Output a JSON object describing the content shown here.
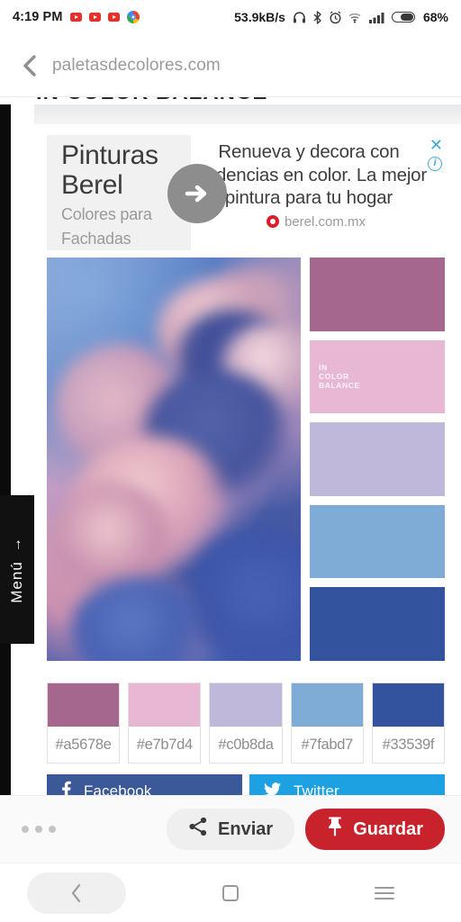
{
  "status_bar": {
    "clock": "4:19 PM",
    "notification_icons": [
      "youtube-icon",
      "youtube-icon",
      "youtube-icon",
      "chrome-icon"
    ],
    "network_speed": "53.9kB/s",
    "right_icons": [
      "headphones-icon",
      "bluetooth-icon",
      "alarm-icon",
      "wifi-icon",
      "cellular-signal-icon",
      "battery-icon"
    ],
    "battery_percent": "68%"
  },
  "browser": {
    "back_label": "back",
    "url": "paletasdecolores.com"
  },
  "page": {
    "clipped_heading": "IN COLOR BALANCE",
    "menu_tab": {
      "label": "Menú",
      "arrow": "→"
    }
  },
  "ad": {
    "brand_line1": "Pinturas",
    "brand_line2": "Berel",
    "sub_line1": "Colores para",
    "sub_line2": "Fachadas",
    "copy": "Renueva y decora con tendencias en color. La mejor pintura para tu hogar",
    "domain": "berel.com.mx",
    "close_label": "✕",
    "info_label": "i",
    "arrow_label": "→"
  },
  "palette": {
    "watermark": "IN\nCOLOR\nBALANCE",
    "swatches": [
      {
        "name": "mauve",
        "hex": "#a5678e"
      },
      {
        "name": "pink",
        "hex": "#e7b7d4"
      },
      {
        "name": "lavender",
        "hex": "#c0b8da"
      },
      {
        "name": "sky-blue",
        "hex": "#7fabd7"
      },
      {
        "name": "royal-blue",
        "hex": "#33539f"
      }
    ]
  },
  "social": {
    "facebook": {
      "label": "Facebook",
      "color": "#3b5998"
    },
    "twitter": {
      "label": "Twitter",
      "color": "#1da1e2"
    }
  },
  "pin_bar": {
    "more_label": "•••",
    "send_label": "Enviar",
    "save_label": "Guardar",
    "save_color": "#c8232c"
  },
  "nav_bar": {
    "back": "back-icon",
    "home": "home-icon",
    "recents": "recents-icon"
  }
}
